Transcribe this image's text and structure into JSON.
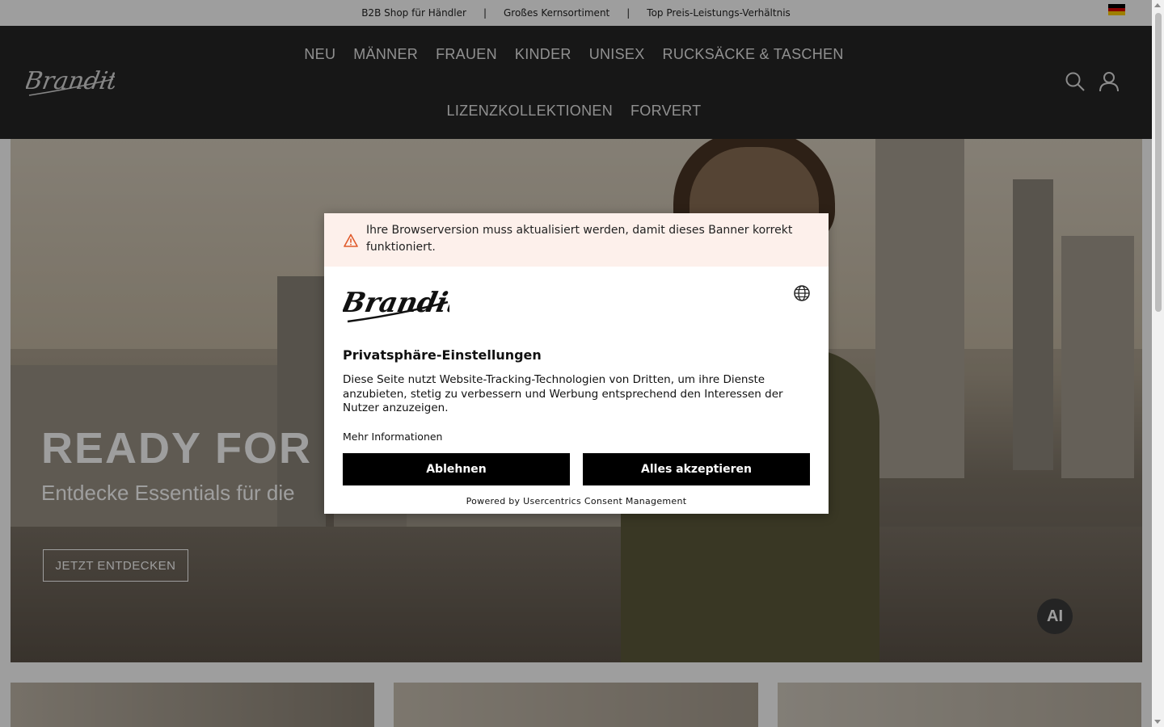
{
  "topbar": {
    "items": [
      "B2B Shop für Händler",
      "Großes Kernsortiment",
      "Top Preis-Leistungs-Verhältnis"
    ],
    "separator": "|",
    "flag_colors": [
      "#000000",
      "#dd0000",
      "#ffce00"
    ]
  },
  "header": {
    "logo_text": "Brandit",
    "nav_row1": [
      "NEU",
      "MÄNNER",
      "FRAUEN",
      "KINDER",
      "UNISEX",
      "RUCKSÄCKE & TASCHEN"
    ],
    "nav_row2": [
      "LIZENZKOLLEKTIONEN",
      "FORVERT"
    ],
    "icons": [
      "search-icon",
      "account-icon"
    ]
  },
  "hero": {
    "title": "READY FOR S",
    "subtitle": "Entdecke Essentials für die",
    "cta": "JETZT ENTDECKEN",
    "ai_button": "AI"
  },
  "consent": {
    "warning": "Ihre Browserversion muss aktualisiert werden, damit dieses Banner korrekt funktioniert.",
    "logo_text": "Brandit",
    "title": "Privatsphäre-Einstellungen",
    "description": "Diese Seite nutzt Website-Tracking-Technologien von Dritten, um ihre Dienste anzubieten, stetig zu verbessern und Werbung entsprechend den Interessen der Nutzer anzuzeigen.",
    "more_info": "Mehr Informationen",
    "decline": "Ablehnen",
    "accept": "Alles akzeptieren",
    "powered_by": "Powered by Usercentrics Consent Management",
    "colors": {
      "warning_bg": "#fdf0eb",
      "warning_icon": "#e05a2b",
      "button_bg": "#000000"
    }
  }
}
